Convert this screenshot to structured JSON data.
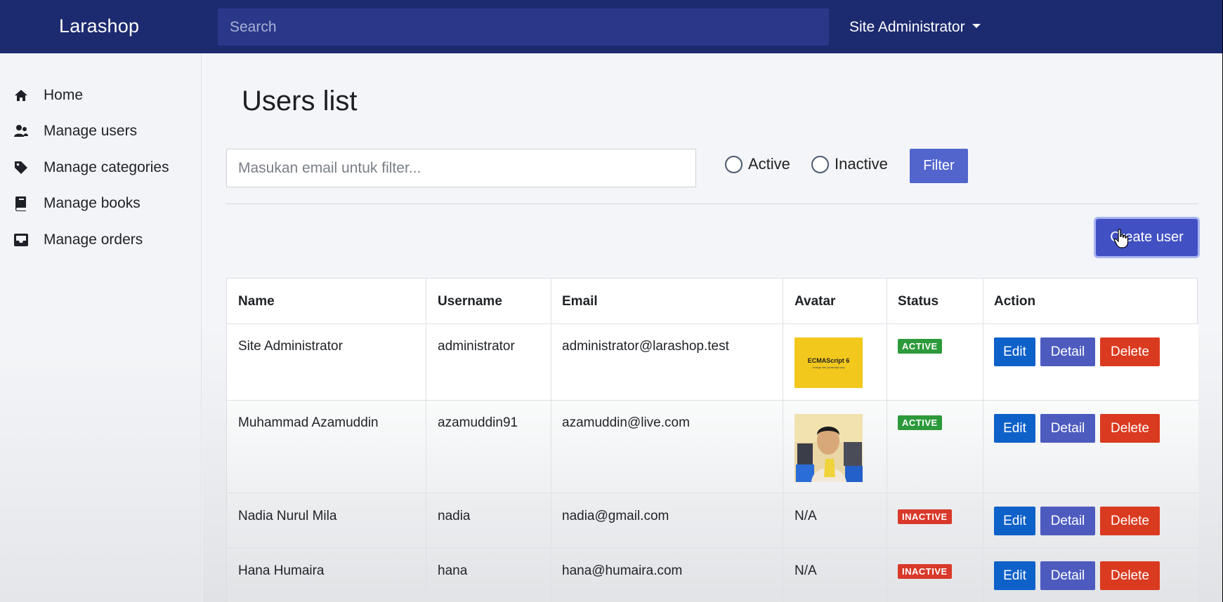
{
  "navbar": {
    "brand": "Larashop",
    "search_placeholder": "Search",
    "user_menu": "Site Administrator"
  },
  "sidebar": {
    "items": [
      {
        "label": "Home",
        "icon": "home-icon"
      },
      {
        "label": "Manage users",
        "icon": "users-icon"
      },
      {
        "label": "Manage categories",
        "icon": "tag-icon"
      },
      {
        "label": "Manage books",
        "icon": "book-icon"
      },
      {
        "label": "Manage orders",
        "icon": "inbox-icon"
      }
    ]
  },
  "main": {
    "title": "Users list",
    "filter_placeholder": "Masukan email untuk filter...",
    "radio_active": "Active",
    "radio_inactive": "Inactive",
    "filter_button": "Filter",
    "create_button": "Create user"
  },
  "table": {
    "headers": [
      "Name",
      "Username",
      "Email",
      "Avatar",
      "Status",
      "Action"
    ],
    "rows": [
      {
        "name": "Site Administrator",
        "username": "administrator",
        "email": "administrator@larashop.test",
        "avatar": "",
        "avatar_text": "ECMAScript 6",
        "avatar_subtext": "change the javascript way",
        "status": "ACTIVE"
      },
      {
        "name": "Muhammad Azamuddin",
        "username": "azamuddin91",
        "email": "azamuddin@live.com",
        "avatar": "",
        "status": "ACTIVE"
      },
      {
        "name": "Nadia Nurul Mila",
        "username": "nadia",
        "email": "nadia@gmail.com",
        "avatar": "N/A",
        "status": "INACTIVE"
      },
      {
        "name": "Hana Humaira",
        "username": "hana",
        "email": "hana@humaira.com",
        "avatar": "N/A",
        "status": "INACTIVE"
      }
    ],
    "actions": {
      "edit": "Edit",
      "detail": "Detail",
      "delete": "Delete"
    }
  },
  "colors": {
    "navbar": "#1c2a6f",
    "primary": "#5265cc",
    "edit": "#0e61c9",
    "detail": "#4d5bbf",
    "delete": "#da3a1f",
    "active_badge": "#2c9a3b",
    "inactive_badge": "#d8392a"
  }
}
